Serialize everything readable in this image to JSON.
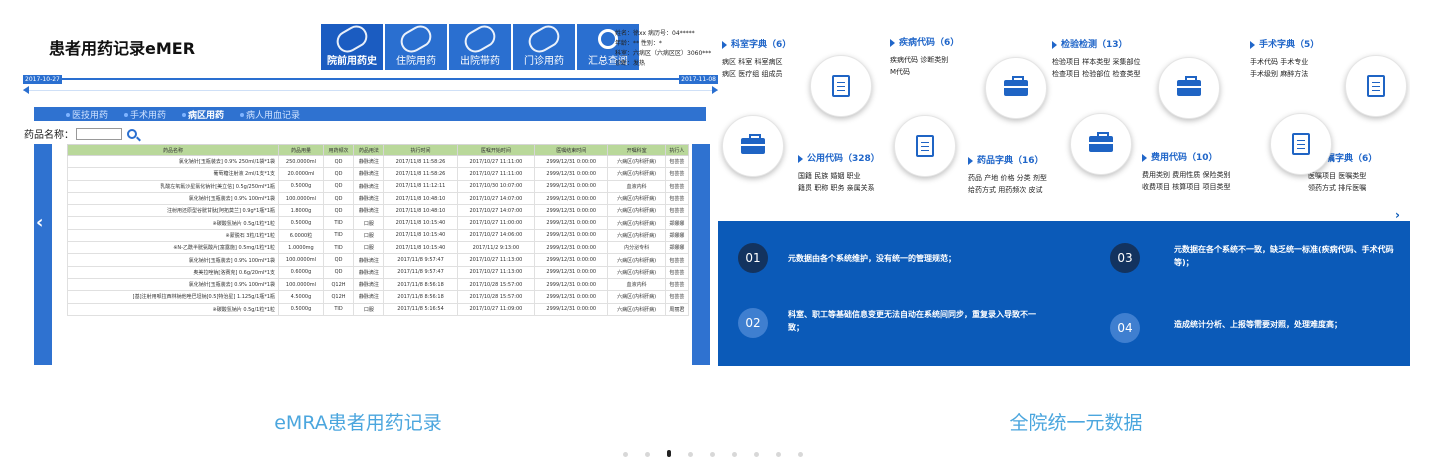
{
  "left_card": {
    "title": "患者用药记录eMER",
    "tabs": [
      {
        "label": "院前用药史",
        "active": true,
        "icon": "pill-icon"
      },
      {
        "label": "住院用药",
        "active": false,
        "icon": "pill-icon"
      },
      {
        "label": "出院带药",
        "active": false,
        "icon": "pill-icon"
      },
      {
        "label": "门诊用药",
        "active": false,
        "icon": "pill-icon"
      },
      {
        "label": "汇总查阅",
        "active": false,
        "icon": "magnifier-icon"
      }
    ],
    "patient_info": [
      "姓名：徐xx   病历号：04*****",
      "年龄：**     性别：*",
      "科室：六病区（六病区区）3060***",
      "诊断：发热"
    ],
    "timeline": {
      "start": "2017-10-27",
      "end": "2017-11-08"
    },
    "subnav": [
      {
        "label": "医技用药",
        "active": false
      },
      {
        "label": "手术用药",
        "active": false
      },
      {
        "label": "病区用药",
        "active": true
      },
      {
        "label": "病人用血记录",
        "active": false
      }
    ],
    "search_label": "药品名称：",
    "table": {
      "headers": [
        "药品名称",
        "药品用量",
        "用药频次",
        "药品用法",
        "执行时间",
        "医嘱开始时间",
        "医嘱结束时间",
        "开嘱科室",
        "执行人"
      ],
      "rows": [
        [
          "氯化钠针[玉瓶装去] 0.9% 250ml/1袋*1袋",
          "250.0000ml",
          "QD",
          "静脉滴注",
          "2017/11/8 11:58:26",
          "2017/10/27 11:11:00",
          "2999/12/31 0:00:00",
          "六病区(内科肝病)",
          "包芸芸"
        ],
        [
          "葡萄糖注射液 2ml/1支*1支",
          "20.0000ml",
          "QD",
          "静脉滴注",
          "2017/11/8 11:58:26",
          "2017/10/27 11:11:00",
          "2999/12/31 0:00:00",
          "六病区(内科肝病)",
          "包芸芸"
        ],
        [
          "乳酸左氧氟沙星氯化钠针[美立信] 0.5g/250ml*1瓶",
          "0.5000g",
          "QD",
          "静脉滴注",
          "2017/11/8 11:12:11",
          "2017/10/30 10:07:00",
          "2999/12/31 0:00:00",
          "血液内科",
          "包芸芸"
        ],
        [
          "氯化钠针[玉瓶装去] 0.9% 100ml*1袋",
          "100.0000ml",
          "QD",
          "静脉滴注",
          "2017/11/8 10:48:10",
          "2017/10/27 14:07:00",
          "2999/12/31 0:00:00",
          "六病区(内科肝病)",
          "包芸芸"
        ],
        [
          "注射用还原型谷胱甘肽[阿拓莫兰] 0.9g*1瓶*1瓶",
          "1.8000g",
          "QD",
          "静脉滴注",
          "2017/11/8 10:48:10",
          "2017/10/27 14:07:00",
          "2999/12/31 0:00:00",
          "六病区(内科肝病)",
          "包芸芸"
        ],
        [
          "※碳酸氢钠片 0.5g/1粒*1粒",
          "0.5000g",
          "TID",
          "口服",
          "2017/11/8 10:15:40",
          "2017/10/27 11:00:00",
          "2999/12/31 0:00:00",
          "六病区(内科肝病)",
          "郑娜娜"
        ],
        [
          "※蒙脱石 3粒/1粒*1粒",
          "6.0000粒",
          "TID",
          "口服",
          "2017/11/8 10:15:40",
          "2017/10/27 14:06:00",
          "2999/12/31 0:00:00",
          "六病区(内科肝病)",
          "郑娜娜"
        ],
        [
          "※N-乙酰半胱氨酸片[富露施] 0.5mg/1粒*1粒",
          "1.0000mg",
          "TID",
          "口服",
          "2017/11/8 10:15:40",
          "2017/11/2 9:13:00",
          "2999/12/31 0:00:00",
          "内分泌专科",
          "郑娜娜"
        ],
        [
          "氯化钠针[玉瓶装去] 0.9% 100ml*1袋",
          "100.0000ml",
          "QD",
          "静脉滴注",
          "2017/11/8 9:57:47",
          "2017/10/27 11:13:00",
          "2999/12/31 0:00:00",
          "六病区(内科肝病)",
          "包芸芸"
        ],
        [
          "奥美拉唑钠[洛赛克] 0.6g/20ml*1支",
          "0.6000g",
          "QD",
          "静脉滴注",
          "2017/11/8 9:57:47",
          "2017/10/27 11:13:00",
          "2999/12/31 0:00:00",
          "六病区(内科肝病)",
          "包芸芸"
        ],
        [
          "氯化钠针[玉瓶装去] 0.9% 100ml*1袋",
          "100.0000ml",
          "Q12H",
          "静脉滴注",
          "2017/11/8 8:56:18",
          "2017/10/28 15:57:00",
          "2999/12/31 0:00:00",
          "血液内科",
          "包芸芸"
        ],
        [
          "[基]注射用哌拉西林钠他唑巴坦钠[0.5]特治星] 1.125g/1瓶*1瓶",
          "4.5000g",
          "Q12H",
          "静脉滴注",
          "2017/11/8 8:56:18",
          "2017/10/28 15:57:00",
          "2999/12/31 0:00:00",
          "六病区(内科肝病)",
          "包芸芸"
        ],
        [
          "※碳酸氢钠片 0.5g/1粒*1粒",
          "0.5000g",
          "TID",
          "口服",
          "2017/11/8 5:16:54",
          "2017/10/27 11:09:00",
          "2999/12/31 0:00:00",
          "六病区(内科肝病)",
          "周丽君"
        ]
      ]
    },
    "caption": "eMRA患者用药记录"
  },
  "right_card": {
    "categories": [
      {
        "title": "科室字典（6）",
        "lines": [
          "病区 科室 科室病区",
          "病区 医疗组 组成员"
        ]
      },
      {
        "title": "疾病代码（6）",
        "lines": [
          "疾病代码 诊断类别",
          "M代码"
        ]
      },
      {
        "title": "检验检测（13）",
        "lines": [
          "检验项目 样本类型 采集部位",
          "检查项目 检验部位 检查类型"
        ]
      },
      {
        "title": "手术字典（5）",
        "lines": [
          "手术代码 手术专业",
          "手术级别 麻醉方法"
        ]
      },
      {
        "title": "公用代码（328）",
        "lines": [
          "国籍 民族 婚姻 职业",
          "籍贯 职称 职务 亲属关系"
        ]
      },
      {
        "title": "药品字典（16）",
        "lines": [
          "药品 产地 价格 分类 剂型",
          "给药方式 用药频次 皮试"
        ]
      },
      {
        "title": "费用代码（10）",
        "lines": [
          "费用类别 费用性质 保险类别",
          "收费项目 核算项目 项目类型"
        ]
      },
      {
        "title": "医嘱字典（6）",
        "lines": [
          "医嘱项目 医嘱类型",
          "领药方式 排斥医嘱"
        ]
      }
    ],
    "issues": [
      {
        "num": "01",
        "text": "元数据由各个系统维护，没有统一的管理规范；"
      },
      {
        "num": "02",
        "text": "科室、职工等基础信息变更无法自动在系统间同步，重复录入导致不一致；"
      },
      {
        "num": "03",
        "text": "元数据在各个系统不一致，缺乏统一标准(疾病代码、手术代码等)；"
      },
      {
        "num": "04",
        "text": "造成统计分析、上报等需要对照，处理难度高；"
      }
    ],
    "caption": "全院统一元数据"
  },
  "carousel": {
    "dots": 9,
    "active": 2
  }
}
